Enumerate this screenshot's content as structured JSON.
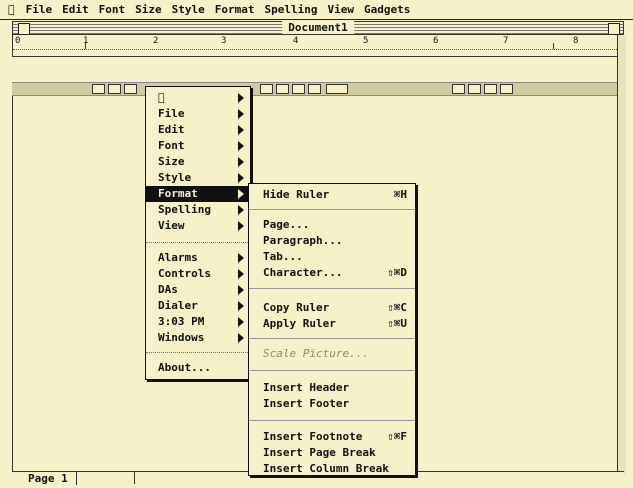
{
  "menubar": {
    "apple": "",
    "items": [
      "File",
      "Edit",
      "Font",
      "Size",
      "Style",
      "Format",
      "Spelling",
      "View",
      "Gadgets"
    ]
  },
  "window": {
    "title": "Document1"
  },
  "ruler": {
    "numbers": [
      "0",
      "1",
      "2",
      "3",
      "4",
      "5",
      "6",
      "7",
      "8"
    ]
  },
  "status": {
    "page_label": "Page 1"
  },
  "main_menu": {
    "apple": "",
    "items": [
      "File",
      "Edit",
      "Font",
      "Size",
      "Style",
      "Format",
      "Spelling",
      "View",
      "Alarms",
      "Controls",
      "DAs",
      "Dialer",
      "3:03 PM",
      "Windows",
      "About..."
    ],
    "selected": "Format"
  },
  "format_menu": {
    "items": [
      {
        "label": "Hide Ruler",
        "shortcut": "⌘H"
      },
      {
        "label": "Page...",
        "shortcut": ""
      },
      {
        "label": "Paragraph...",
        "shortcut": ""
      },
      {
        "label": "Tab...",
        "shortcut": ""
      },
      {
        "label": "Character...",
        "shortcut": "⇧⌘D"
      },
      {
        "label": "Copy Ruler",
        "shortcut": "⇧⌘C"
      },
      {
        "label": "Apply Ruler",
        "shortcut": "⇧⌘U"
      },
      {
        "label": "Scale Picture...",
        "shortcut": ""
      },
      {
        "label": "Insert Header",
        "shortcut": ""
      },
      {
        "label": "Insert Footer",
        "shortcut": ""
      },
      {
        "label": "Insert Footnote",
        "shortcut": "⇧⌘F"
      },
      {
        "label": "Insert Page Break",
        "shortcut": ""
      },
      {
        "label": "Insert Column Break",
        "shortcut": ""
      }
    ]
  }
}
